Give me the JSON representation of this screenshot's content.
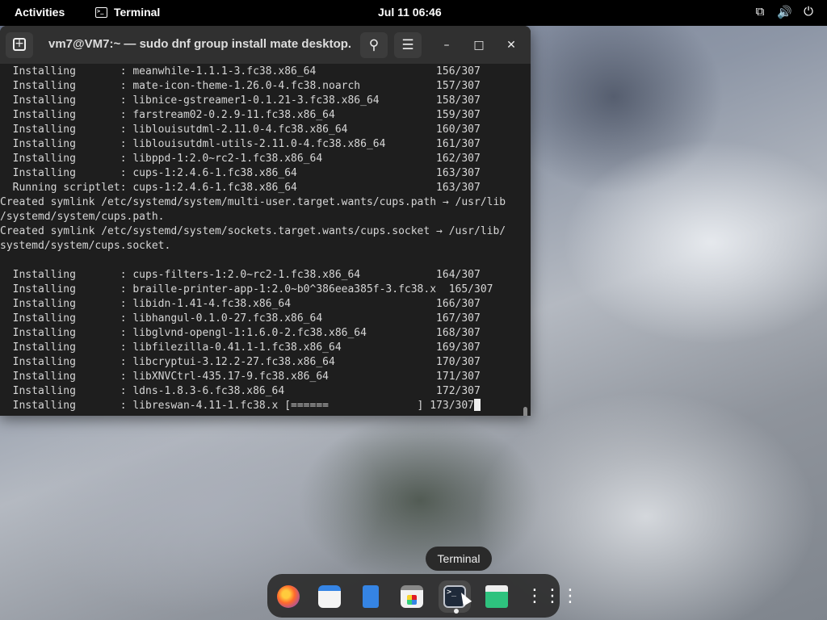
{
  "topbar": {
    "activities": "Activities",
    "app_name": "Terminal",
    "app_icon": ">_",
    "clock": "Jul 11  06:46",
    "tray": {
      "network_icon": "⧉",
      "volume_icon": "🔊",
      "power_icon": "⏻"
    }
  },
  "window": {
    "title": "vm7@VM7:~ — sudo dnf group install mate desktop...",
    "new_tab_glyph": "+",
    "search_glyph": "⚲",
    "menu_glyph": "☰",
    "minimize_glyph": "–",
    "maximize_glyph": "□",
    "close_glyph": "✕"
  },
  "terminal": {
    "lines": [
      "  Installing       : meanwhile-1.1.1-3.fc38.x86_64                   156/307",
      "  Installing       : mate-icon-theme-1.26.0-4.fc38.noarch            157/307",
      "  Installing       : libnice-gstreamer1-0.1.21-3.fc38.x86_64         158/307",
      "  Installing       : farstream02-0.2.9-11.fc38.x86_64                159/307",
      "  Installing       : liblouisutdml-2.11.0-4.fc38.x86_64              160/307",
      "  Installing       : liblouisutdml-utils-2.11.0-4.fc38.x86_64        161/307",
      "  Installing       : libppd-1:2.0~rc2-1.fc38.x86_64                  162/307",
      "  Installing       : cups-1:2.4.6-1.fc38.x86_64                      163/307",
      "  Running scriptlet: cups-1:2.4.6-1.fc38.x86_64                      163/307",
      "Created symlink /etc/systemd/system/multi-user.target.wants/cups.path → /usr/lib",
      "/systemd/system/cups.path.",
      "Created symlink /etc/systemd/system/sockets.target.wants/cups.socket → /usr/lib/",
      "systemd/system/cups.socket.",
      "",
      "  Installing       : cups-filters-1:2.0~rc2-1.fc38.x86_64            164/307",
      "  Installing       : braille-printer-app-1:2.0~b0^386eea385f-3.fc38.x  165/307",
      "  Installing       : libidn-1.41-4.fc38.x86_64                       166/307",
      "  Installing       : libhangul-0.1.0-27.fc38.x86_64                  167/307",
      "  Installing       : libglvnd-opengl-1:1.6.0-2.fc38.x86_64           168/307",
      "  Installing       : libfilezilla-0.41.1-1.fc38.x86_64               169/307",
      "  Installing       : libcryptui-3.12.2-27.fc38.x86_64                170/307",
      "  Installing       : libXNVCtrl-435.17-9.fc38.x86_64                 171/307",
      "  Installing       : ldns-1.8.3-6.fc38.x86_64                        172/307",
      "  Installing       : libreswan-4.11-1.fc38.x [======              ] 173/307"
    ]
  },
  "tooltip": "Terminal",
  "dock": {
    "items": [
      {
        "name": "Firefox"
      },
      {
        "name": "Calendar"
      },
      {
        "name": "Text Editor"
      },
      {
        "name": "Software"
      },
      {
        "name": "Terminal",
        "glyph": ">_"
      },
      {
        "name": "Trash"
      },
      {
        "name": "Show Applications",
        "glyph": "⋮⋮⋮"
      }
    ]
  }
}
